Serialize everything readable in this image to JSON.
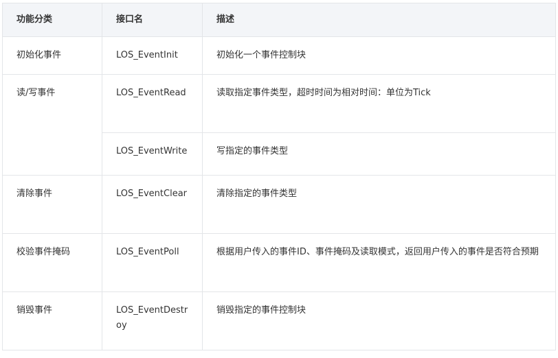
{
  "table": {
    "headers": [
      "功能分类",
      "接口名",
      "描述"
    ],
    "rows": [
      {
        "category": "初始化事件",
        "api": "LOS_EventInit",
        "desc": "初始化一个事件控制块"
      },
      {
        "category": "读/写事件",
        "api": "LOS_EventRead",
        "desc": "读取指定事件类型，超时时间为相对时间：单位为Tick"
      },
      {
        "category": "",
        "api": "LOS_EventWrite",
        "desc": "写指定的事件类型"
      },
      {
        "category": "清除事件",
        "api": "LOS_EventClear",
        "desc": "清除指定的事件类型"
      },
      {
        "category": "校验事件掩码",
        "api": "LOS_EventPoll",
        "desc": "根据用户传入的事件ID、事件掩码及读取模式，返回用户传入的事件是否符合预期"
      },
      {
        "category": "销毁事件",
        "api": "LOS_EventDestroy",
        "desc": "销毁指定的事件控制块"
      }
    ]
  }
}
